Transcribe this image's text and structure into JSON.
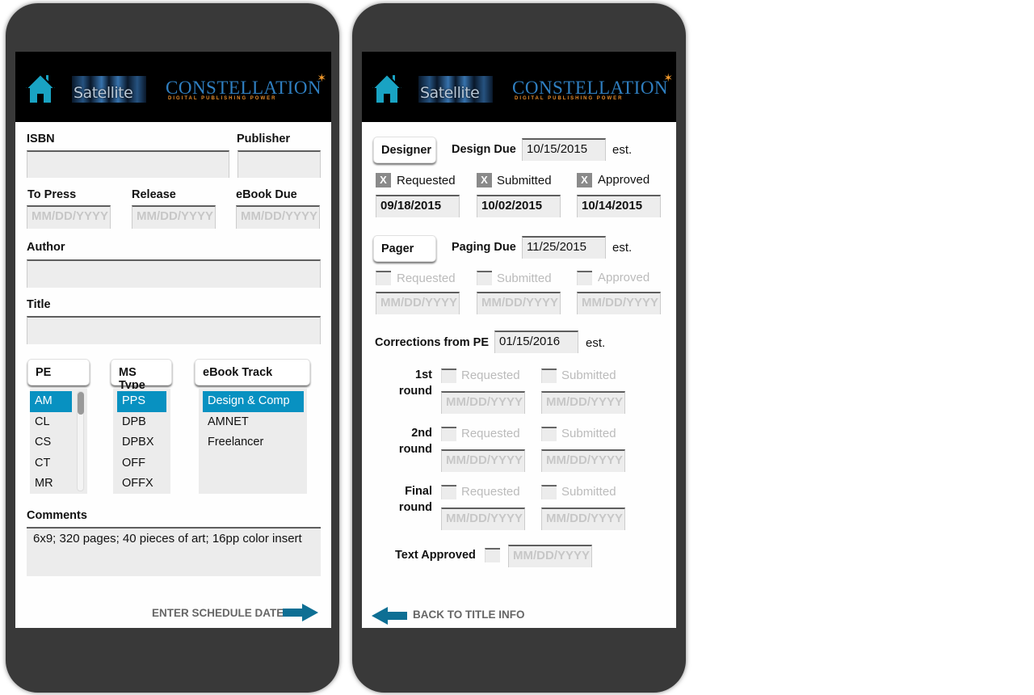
{
  "header": {
    "home_icon": "home-icon",
    "satellite_logo": "Satellite",
    "constellation_logo": {
      "title": "CONSTELLATION",
      "subtitle": "DIGITAL PUBLISHING POWER"
    }
  },
  "title_info": {
    "isbn": {
      "label": "ISBN",
      "value": ""
    },
    "publisher": {
      "label": "Publisher",
      "value": ""
    },
    "to_press": {
      "label": "To Press",
      "placeholder": "MM/DD/YYYY"
    },
    "release": {
      "label": "Release",
      "placeholder": "MM/DD/YYYY"
    },
    "ebook_due": {
      "label": "eBook Due",
      "placeholder": "MM/DD/YYYY"
    },
    "author": {
      "label": "Author",
      "value": ""
    },
    "title": {
      "label": "Title",
      "value": ""
    },
    "pe": {
      "label": "PE",
      "options": [
        "AM",
        "CL",
        "CS",
        "CT",
        "MR"
      ],
      "selected": "AM"
    },
    "ms_type": {
      "label": "MS Type",
      "options": [
        "PPS",
        "DPB",
        "DPBX",
        "OFF",
        "OFFX"
      ],
      "selected": "PPS"
    },
    "ebook_track": {
      "label": "eBook Track",
      "options": [
        "Design & Comp",
        "AMNET",
        "Freelancer"
      ],
      "selected": "Design & Comp"
    },
    "comments": {
      "label": "Comments",
      "value": "6x9; 320 pages; 40 pieces of art; 16pp color insert"
    },
    "next_link": "ENTER SCHEDULE DATES"
  },
  "schedule": {
    "designer": {
      "button": "Designer",
      "due_label": "Design Due",
      "due_value": "10/15/2015",
      "est": "est.",
      "requested": {
        "label": "Requested",
        "checked": true,
        "mark": "X",
        "date": "09/18/2015"
      },
      "submitted": {
        "label": "Submitted",
        "checked": true,
        "mark": "X",
        "date": "10/02/2015"
      },
      "approved": {
        "label": "Approved",
        "checked": true,
        "mark": "X",
        "date": "10/14/2015"
      }
    },
    "pager": {
      "button": "Pager",
      "due_label": "Paging Due",
      "due_value": "11/25/2015",
      "est": "est.",
      "requested": {
        "label": "Requested",
        "checked": false,
        "placeholder": "MM/DD/YYYY"
      },
      "submitted": {
        "label": "Submitted",
        "checked": false,
        "placeholder": "MM/DD/YYYY"
      },
      "approved": {
        "label": "Approved",
        "checked": false,
        "placeholder": "MM/DD/YYYY"
      }
    },
    "corrections": {
      "label": "Corrections from PE",
      "value": "01/15/2016",
      "est": "est.",
      "rounds": [
        {
          "label_line1": "1st",
          "label_line2": "round",
          "requested": "Requested",
          "submitted": "Submitted",
          "placeholder": "MM/DD/YYYY"
        },
        {
          "label_line1": "2nd",
          "label_line2": "round",
          "requested": "Requested",
          "submitted": "Submitted",
          "placeholder": "MM/DD/YYYY"
        },
        {
          "label_line1": "Final",
          "label_line2": "round",
          "requested": "Requested",
          "submitted": "Submitted",
          "placeholder": "MM/DD/YYYY"
        }
      ]
    },
    "text_approved": {
      "label": "Text Approved",
      "checked": false,
      "placeholder": "MM/DD/YYYY"
    },
    "back_link": "BACK TO TITLE INFO"
  },
  "colors": {
    "accent": "#0891c1",
    "arrow": "#0e6f94",
    "bezel": "#393939"
  }
}
